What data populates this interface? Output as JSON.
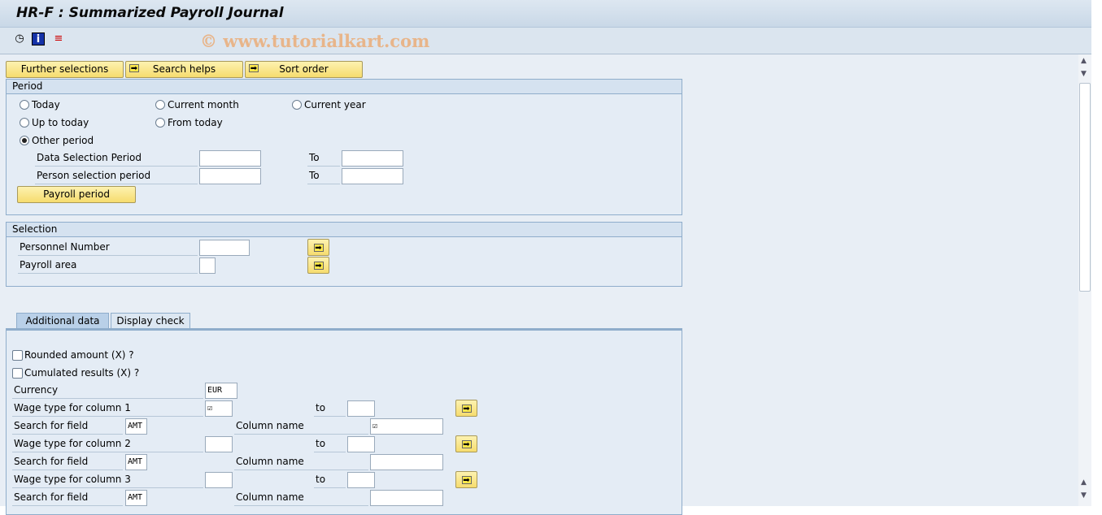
{
  "title": "HR-F : Summarized Payroll Journal",
  "toolbar": {
    "icons": [
      "execute-clock-icon",
      "info-icon",
      "variant-icon"
    ]
  },
  "watermark": "© www.tutorialkart.com",
  "buttons": {
    "further": "Further selections",
    "search": "Search helps",
    "sort": "Sort order"
  },
  "period": {
    "title": "Period",
    "today": "Today",
    "current_month": "Current month",
    "current_year": "Current year",
    "up_to_today": "Up to today",
    "from_today": "From today",
    "other": "Other period",
    "selected": "Other period",
    "data_sel": "Data Selection Period",
    "person_sel": "Person selection period",
    "to": "To",
    "payroll_btn": "Payroll period"
  },
  "selection": {
    "title": "Selection",
    "pernr": "Personnel Number",
    "area": "Payroll area"
  },
  "tabs": {
    "additional": "Additional data",
    "display": "Display check",
    "active": "Additional data"
  },
  "additional": {
    "rounded": "Rounded amount (X) ?",
    "cumulated": "Cumulated results (X) ?",
    "currency_label": "Currency",
    "currency": "EUR",
    "to": "to",
    "search_label": "Search for field",
    "column_label": "Column name",
    "rows": [
      {
        "wage": "Wage type for column 1",
        "search": "AMT",
        "wage_value": "☑",
        "col_value": "☑"
      },
      {
        "wage": "Wage type for column 2",
        "search": "AMT",
        "wage_value": "",
        "col_value": ""
      },
      {
        "wage": "Wage type for column 3",
        "search": "AMT",
        "wage_value": "",
        "col_value": ""
      }
    ]
  }
}
